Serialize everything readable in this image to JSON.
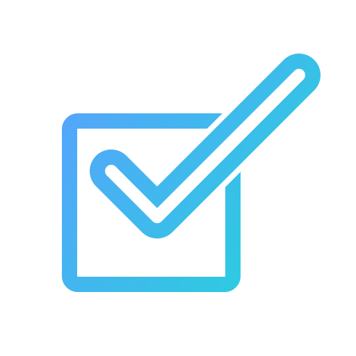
{
  "icon": {
    "name": "checkbox-checked-icon",
    "colors": {
      "gradient_start": "#55a5fb",
      "gradient_end": "#21d6d8",
      "background": "#ffffff"
    }
  }
}
